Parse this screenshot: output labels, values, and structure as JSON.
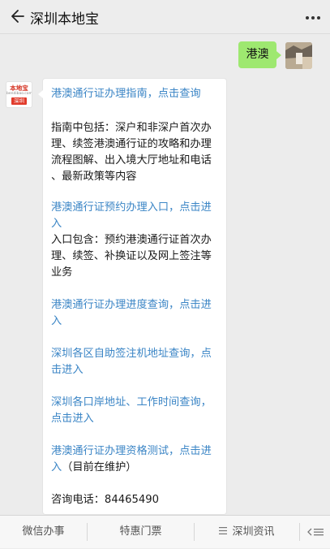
{
  "header": {
    "title": "深圳本地宝"
  },
  "chat": {
    "outgoing": {
      "text": "港澳"
    },
    "incoming": {
      "avatar": {
        "brand": "本地宝",
        "sub": "bendibao.com",
        "city": "深圳"
      },
      "lines": [
        {
          "text": "港澳通行证办理指南，点击查询",
          "kind": "link"
        },
        {
          "text": "指南中包括：深户和非深户首次办",
          "kind": "text"
        },
        {
          "text": "理、续签港澳通行证的攻略和办理",
          "kind": "text"
        },
        {
          "text": "流程图解、出入境大厅地址和电话",
          "kind": "text"
        },
        {
          "text": "、最新政策等内容",
          "kind": "text"
        },
        {
          "text": "港澳通行证预约办理入口，点击进",
          "kind": "link"
        },
        {
          "text": "入",
          "kind": "link"
        },
        {
          "text": "入口包含：预约港澳通行证首次办",
          "kind": "text"
        },
        {
          "text": "理、续签、补换证以及网上签注等",
          "kind": "text"
        },
        {
          "text": "业务",
          "kind": "text"
        },
        {
          "text": "港澳通行证办理进度查询，点击进",
          "kind": "link"
        },
        {
          "text": "入",
          "kind": "link"
        },
        {
          "text": "深圳各区自助签注机地址查询，点",
          "kind": "link"
        },
        {
          "text": "击进入",
          "kind": "link"
        },
        {
          "text": "深圳各口岸地址、工作时间查询，",
          "kind": "link"
        },
        {
          "text": "点击进入",
          "kind": "link"
        },
        {
          "text": "港澳通行证办理资格测试，点击进",
          "kind": "link"
        },
        {
          "text": "入",
          "kind": "link",
          "suffix": "（目前在维护）"
        },
        {
          "text": "咨询电话：84465490",
          "kind": "text"
        }
      ]
    }
  },
  "menu": {
    "items": [
      {
        "label": "微信办事"
      },
      {
        "label": "特惠门票"
      },
      {
        "label": "深圳资讯",
        "icon": "list-icon"
      }
    ],
    "keyboard_icon": "keyboard-toggle-icon"
  },
  "colors": {
    "link": "#3c86c6",
    "bubble_me": "#9ee870",
    "background": "#ececec"
  }
}
